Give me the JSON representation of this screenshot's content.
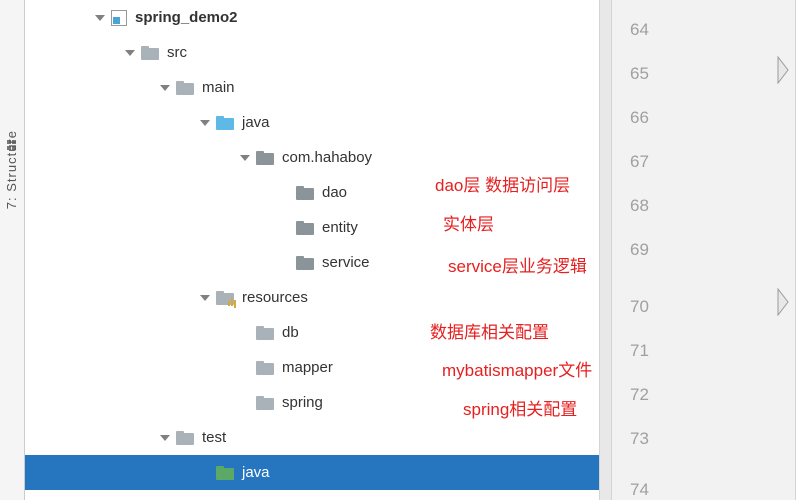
{
  "sidebar": {
    "label": "7: Structure"
  },
  "tree": {
    "root": {
      "label": "spring_demo2"
    },
    "src": {
      "label": "src"
    },
    "main": {
      "label": "main"
    },
    "java": {
      "label": "java"
    },
    "pkg": {
      "label": "com.hahaboy"
    },
    "dao": {
      "label": "dao"
    },
    "entity": {
      "label": "entity"
    },
    "service": {
      "label": "service"
    },
    "resources": {
      "label": "resources"
    },
    "db": {
      "label": "db"
    },
    "mapper": {
      "label": "mapper"
    },
    "spring": {
      "label": "spring"
    },
    "test": {
      "label": "test"
    },
    "testjava": {
      "label": "java"
    }
  },
  "annotations": {
    "dao": "dao层 数据访问层",
    "entity": "实体层",
    "service": "service层业务逻辑",
    "db": "数据库相关配置",
    "mapper": "mybatismapper文件",
    "spring": "spring相关配置"
  },
  "gutter": {
    "lines": [
      "64",
      "65",
      "66",
      "67",
      "68",
      "69",
      "70",
      "71",
      "72",
      "73",
      "74"
    ]
  }
}
